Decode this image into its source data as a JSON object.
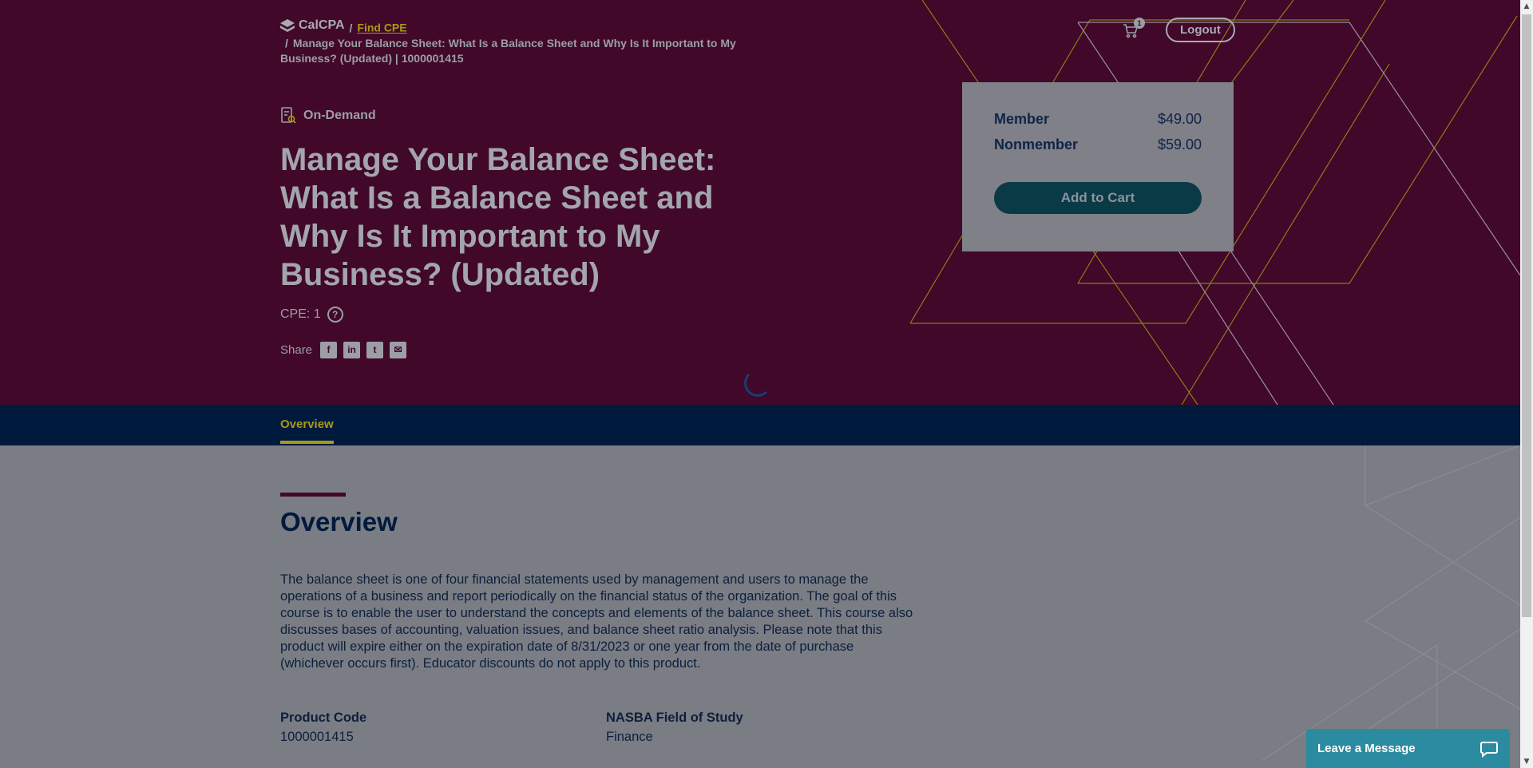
{
  "header": {
    "brand": "CalCPA",
    "crumb_link": "Find CPE",
    "crumb_current": "Manage Your Balance Sheet: What Is a Balance Sheet and Why Is It Important to My Business? (Updated) | 1000001415",
    "separator": "/",
    "cart_count": "1",
    "logout_label": "Logout"
  },
  "product": {
    "format": "On-Demand",
    "title": "Manage Your Balance Sheet: What Is a Balance Sheet and Why Is It Important to My Business? (Updated)",
    "cpe": "CPE: 1",
    "help_glyph": "?",
    "share_label": "Share"
  },
  "pricing": {
    "member_label": "Member",
    "member_price": "$49.00",
    "nonmember_label": "Nonmember",
    "nonmember_price": "$59.00",
    "add_to_cart_label": "Add to Cart"
  },
  "tabs": [
    {
      "label": "Overview",
      "active": true
    }
  ],
  "overview": {
    "heading": "Overview",
    "body": "The balance sheet is one of four financial statements used by management and users to manage the operations of a business and report periodically on the financial status of the organization. The goal of this course is to enable the user to understand the concepts and elements of the balance sheet. This course also discusses bases of accounting, valuation issues, and balance sheet ratio analysis. Please note that this product will expire either on the expiration date of 8/31/2023 or one year from the date of purchase (whichever occurs first). Educator discounts do not apply to this product.",
    "fields": [
      {
        "label": "Product Code",
        "value": "1000001415"
      },
      {
        "label": "NASBA Field of Study",
        "value": "Finance"
      }
    ]
  },
  "chat": {
    "label": "Leave a Message"
  },
  "colors": {
    "hero_bg": "#410829",
    "tabbar_bg": "#001a3d",
    "accent_gold": "#a89a16",
    "button_teal": "#0b3a47",
    "chat_bg": "#2b8ba1"
  },
  "icons": {
    "brand": "calcpa-logo-icon",
    "cart": "cart-icon",
    "format": "on-demand-icon",
    "help": "question-circle-icon",
    "share": [
      "facebook-icon",
      "linkedin-icon",
      "twitter-icon",
      "email-icon"
    ],
    "chat": "chat-bubble-icon"
  }
}
